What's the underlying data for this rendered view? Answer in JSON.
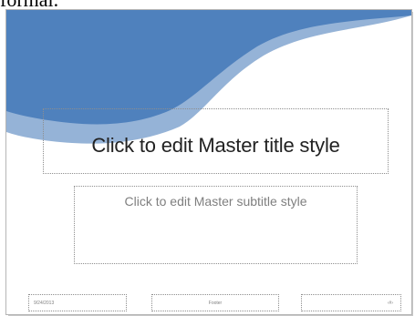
{
  "caption_fragment": "formal.",
  "slide": {
    "title_placeholder": "Click to edit Master title style",
    "subtitle_placeholder": "Click to edit Master subtitle style",
    "date": "9/24/2013",
    "footer": "Footer",
    "slide_number": "‹#›"
  },
  "colors": {
    "accent_dark": "#4f81bd",
    "accent_light": "#95b3d7"
  }
}
